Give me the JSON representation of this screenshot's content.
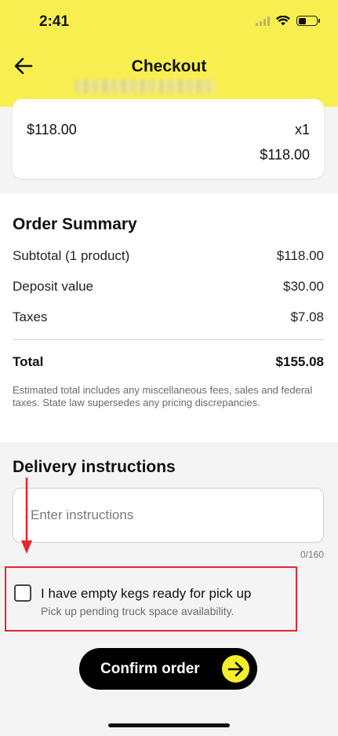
{
  "status_bar": {
    "time": "2:41"
  },
  "header": {
    "title": "Checkout",
    "back_icon": "arrow-left-icon"
  },
  "product": {
    "price": "$118.00",
    "quantity": "x1",
    "line_total": "$118.00"
  },
  "summary": {
    "title": "Order Summary",
    "rows": [
      {
        "label": "Subtotal (1 product)",
        "value": "$118.00"
      },
      {
        "label": "Deposit value",
        "value": "$30.00"
      },
      {
        "label": "Taxes",
        "value": "$7.08"
      }
    ],
    "total": {
      "label": "Total",
      "value": "$155.08"
    },
    "disclaimer": "Estimated total includes any miscellaneous fees, sales and federal taxes. State law supersedes any pricing discrepancies."
  },
  "delivery": {
    "title": "Delivery instructions",
    "placeholder": "Enter instructions",
    "value": "",
    "counter": "0/160"
  },
  "kegs": {
    "label": "I have empty kegs ready for pick up",
    "sub": "Pick up pending truck space availability.",
    "checked": false
  },
  "confirm": {
    "label": "Confirm order",
    "icon": "arrow-right-circle-icon"
  },
  "colors": {
    "brand_yellow": "#f8ee4f",
    "annotation_red": "#e8252a"
  }
}
